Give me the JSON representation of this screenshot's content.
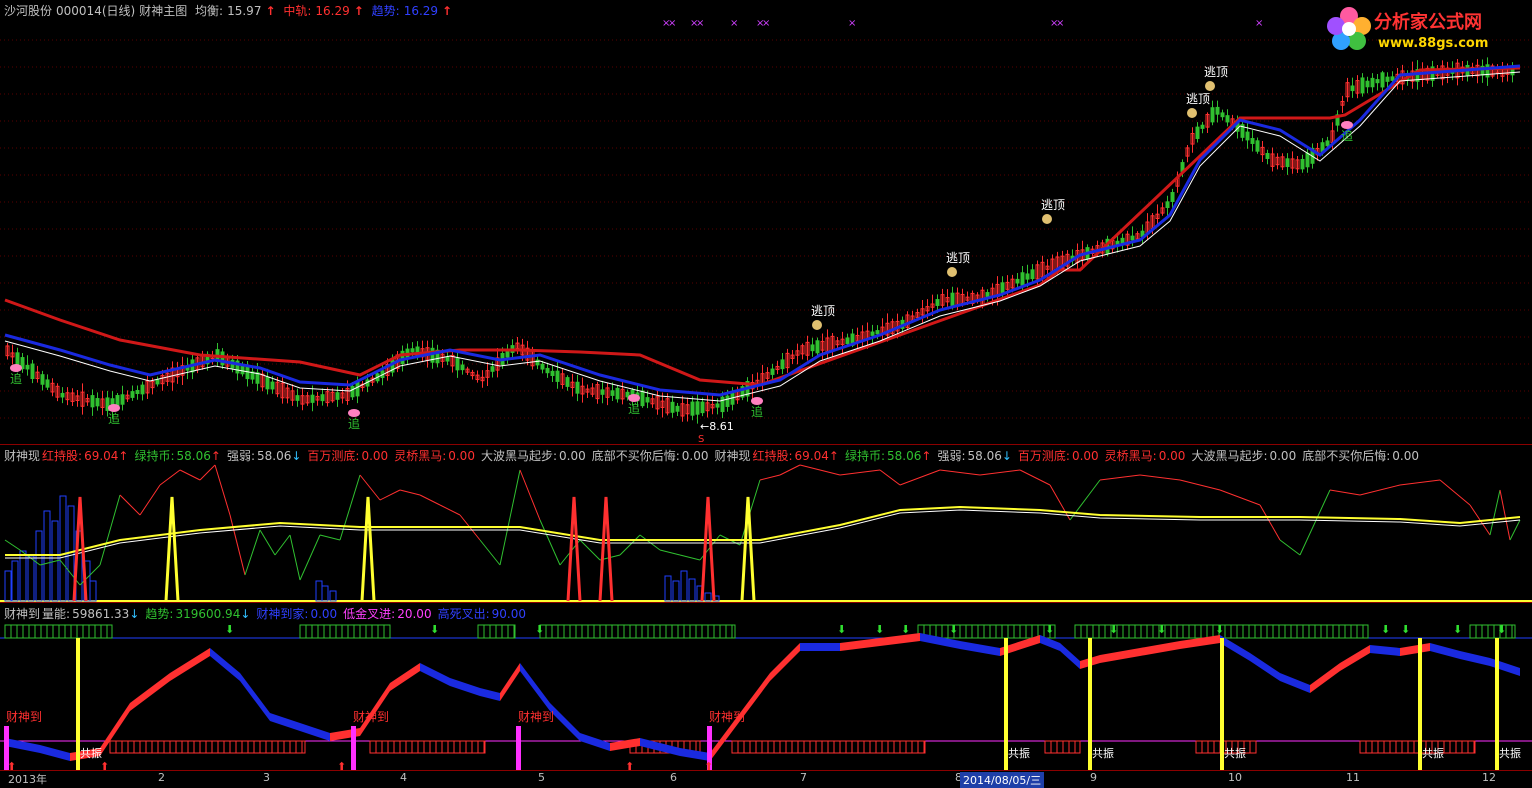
{
  "main_header": {
    "name": "沙河股份",
    "code": "000014(日线)",
    "title": "财神主图",
    "avg_label": "均衡:",
    "avg_value": "15.97",
    "mid_label": "中轨:",
    "mid_value": "16.29",
    "trend_label": "趋势:",
    "trend_value": "16.29"
  },
  "brand": {
    "title": "分析家公式网",
    "url": "www.88gs.com"
  },
  "main_annotations": {
    "escape_top": "逃顶",
    "chase": "追",
    "low_price": "8.61",
    "s_mark": "S"
  },
  "ind1_header": [
    {
      "label": "财神现",
      "value": "",
      "color": "#c0c0c0"
    },
    {
      "label": "红持股:",
      "value": "69.04",
      "arrow": "↑",
      "color": "#ff3030"
    },
    {
      "label": "绿持币:",
      "value": "58.06",
      "arrow": "↑",
      "color": "#30c030"
    },
    {
      "label": "强弱:",
      "value": "58.06",
      "arrow": "↓",
      "color": "#c0c0c0"
    },
    {
      "label": "百万测底:",
      "value": "0.00",
      "color": "#ff3030"
    },
    {
      "label": "灵桥黑马:",
      "value": "0.00",
      "color": "#ff3030"
    },
    {
      "label": "大波黑马起步:",
      "value": "0.00",
      "color": "#c0c0c0"
    },
    {
      "label": "底部不买你后悔:",
      "value": "0.00",
      "color": "#c0c0c0"
    },
    {
      "label": "财神现",
      "value": "",
      "color": "#c0c0c0"
    },
    {
      "label": "红持股:",
      "value": "69.04",
      "arrow": "↑",
      "color": "#ff3030"
    },
    {
      "label": "绿持币:",
      "value": "58.06",
      "arrow": "↑",
      "color": "#30c030"
    },
    {
      "label": "强弱:",
      "value": "58.06",
      "arrow": "↓",
      "color": "#c0c0c0"
    },
    {
      "label": "百万测底:",
      "value": "0.00",
      "color": "#ff3030"
    },
    {
      "label": "灵桥黑马:",
      "value": "0.00",
      "color": "#ff3030"
    },
    {
      "label": "大波黑马起步:",
      "value": "0.00",
      "color": "#c0c0c0"
    },
    {
      "label": "底部不买你后悔:",
      "value": "0.00",
      "color": "#c0c0c0"
    }
  ],
  "ind2_header": [
    {
      "label": "财神到",
      "value": "",
      "color": "#c0c0c0"
    },
    {
      "label": "量能:",
      "value": "59861.33",
      "arrow": "↓",
      "color": "#c0c0c0"
    },
    {
      "label": "趋势:",
      "value": "319600.94",
      "arrow": "↓",
      "color": "#30c030"
    },
    {
      "label": "财神到家:",
      "value": "0.00",
      "color": "#3040ff"
    },
    {
      "label": "低金叉进:",
      "value": "20.00",
      "color": "#ff40ff"
    },
    {
      "label": "高死叉出:",
      "value": "90.00",
      "color": "#3040ff"
    }
  ],
  "ind2_annotations": {
    "god_arrives": "财神到",
    "resonance": "共振"
  },
  "time_axis": {
    "labels": [
      "2013年",
      "2",
      "3",
      "4",
      "5",
      "6",
      "7",
      "8",
      "9",
      "10",
      "11",
      "12"
    ],
    "cursor_date": "2014/08/05/三"
  },
  "colors": {
    "up": "#ff3030",
    "down": "#30c030",
    "trend_line": "#1a2ae0",
    "mid_line": "#d01818",
    "avg_line": "#ffffff",
    "yellow": "#ffff30",
    "magenta": "#ff30ff"
  }
}
